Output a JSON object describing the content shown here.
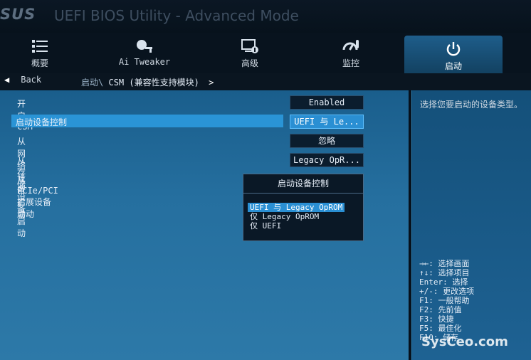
{
  "header": {
    "brand": "SUS",
    "title": "UEFI BIOS Utility - Advanced Mode"
  },
  "tabs": [
    {
      "label": "概要",
      "icon": "list-icon"
    },
    {
      "label": "Ai Tweaker",
      "icon": "tweaker-icon"
    },
    {
      "label": "高级",
      "icon": "advanced-icon"
    },
    {
      "label": "监控",
      "icon": "monitor-icon"
    },
    {
      "label": "启动",
      "icon": "power-icon"
    }
  ],
  "nav": {
    "back_label": "Back",
    "crumb_parent": "启动\\",
    "crumb_current": "CSM (兼容性支持模块)"
  },
  "settings": [
    {
      "label": "开启 CSM",
      "value": "Enabled"
    },
    {
      "label": "启动设备控制",
      "value": "UEFI 与 Le..."
    },
    {
      "label": "从网络设备启动",
      "value": "忽略"
    },
    {
      "label": "从存储设备启动",
      "value": "Legacy OpR..."
    },
    {
      "label": "从 PCIe/PCI 扩展设备启动",
      "value": ""
    }
  ],
  "popup": {
    "title": "启动设备控制",
    "options": [
      "UEFI 与 Legacy OpROM",
      "仅 Legacy OpROM",
      "仅 UEFI"
    ]
  },
  "help": {
    "description": "选择您要启动的设备类型。",
    "keys": [
      "→←: 选择画面",
      "↑↓: 选择项目",
      "Enter: 选择",
      "+/-: 更改选项",
      "F1: 一般帮助",
      "F2: 先前值",
      "F3: 快捷",
      "F5: 最佳化",
      "F10: 储存"
    ]
  },
  "watermark": "SysCeo.com",
  "colors": {
    "accent": "#2a94d6",
    "panel": "#1e6896",
    "dark": "#07111c"
  }
}
